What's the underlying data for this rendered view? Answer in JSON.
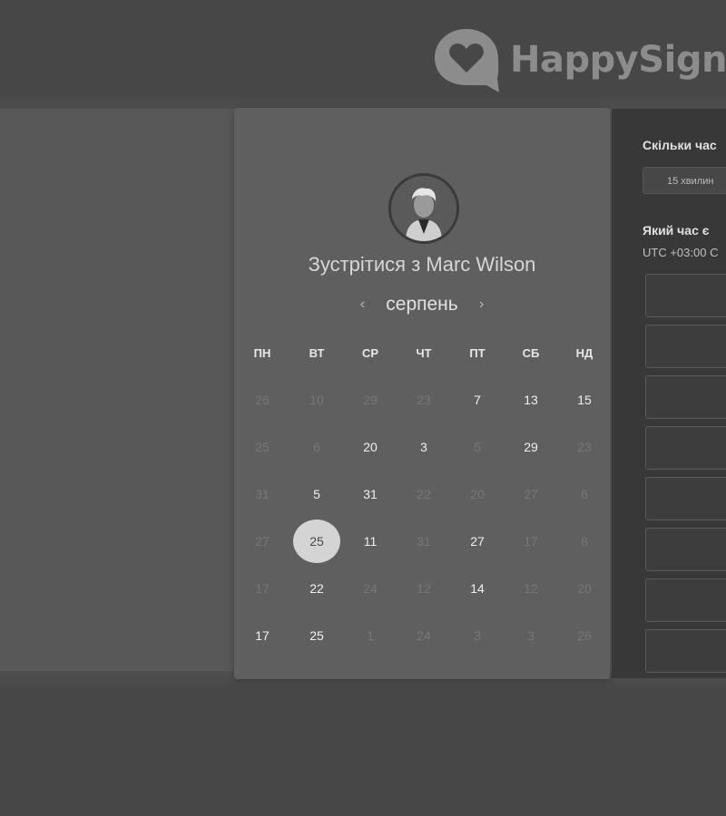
{
  "brand": {
    "name": "HappySign"
  },
  "calendar": {
    "meet_prefix": "Зустрітися з",
    "host_name": "Marc Wilson",
    "month": "серпень",
    "prev_icon": "chevron-left-icon",
    "next_icon": "chevron-right-icon",
    "weekdays": [
      "ПН",
      "ВТ",
      "СР",
      "ЧТ",
      "ПТ",
      "СБ",
      "НД"
    ],
    "weeks": [
      [
        {
          "d": "26",
          "a": false
        },
        {
          "d": "10",
          "a": false
        },
        {
          "d": "29",
          "a": false
        },
        {
          "d": "23",
          "a": false
        },
        {
          "d": "7",
          "a": true
        },
        {
          "d": "13",
          "a": true
        },
        {
          "d": "15",
          "a": true
        }
      ],
      [
        {
          "d": "25",
          "a": false
        },
        {
          "d": "6",
          "a": false
        },
        {
          "d": "20",
          "a": true
        },
        {
          "d": "3",
          "a": true
        },
        {
          "d": "5",
          "a": false
        },
        {
          "d": "29",
          "a": true
        },
        {
          "d": "23",
          "a": false
        }
      ],
      [
        {
          "d": "31",
          "a": false
        },
        {
          "d": "5",
          "a": true
        },
        {
          "d": "31",
          "a": true
        },
        {
          "d": "22",
          "a": false
        },
        {
          "d": "20",
          "a": false
        },
        {
          "d": "27",
          "a": false
        },
        {
          "d": "6",
          "a": false
        }
      ],
      [
        {
          "d": "27",
          "a": false
        },
        {
          "d": "25",
          "a": true,
          "selected": true
        },
        {
          "d": "11",
          "a": true
        },
        {
          "d": "31",
          "a": false
        },
        {
          "d": "27",
          "a": true
        },
        {
          "d": "17",
          "a": false
        },
        {
          "d": "8",
          "a": false
        }
      ],
      [
        {
          "d": "17",
          "a": false
        },
        {
          "d": "22",
          "a": true
        },
        {
          "d": "24",
          "a": false
        },
        {
          "d": "12",
          "a": false
        },
        {
          "d": "14",
          "a": true
        },
        {
          "d": "12",
          "a": false
        },
        {
          "d": "20",
          "a": false
        }
      ],
      [
        {
          "d": "17",
          "a": true
        },
        {
          "d": "25",
          "a": true
        },
        {
          "d": "1",
          "a": false
        },
        {
          "d": "24",
          "a": false
        },
        {
          "d": "3",
          "a": false
        },
        {
          "d": "3",
          "a": false
        },
        {
          "d": "26",
          "a": false
        }
      ]
    ]
  },
  "panel": {
    "duration_question": "Скільки час",
    "duration_button": "15 хвилин",
    "time_question": "Який час є",
    "timezone": "UTC +03:00 С",
    "slot_count": 8
  }
}
